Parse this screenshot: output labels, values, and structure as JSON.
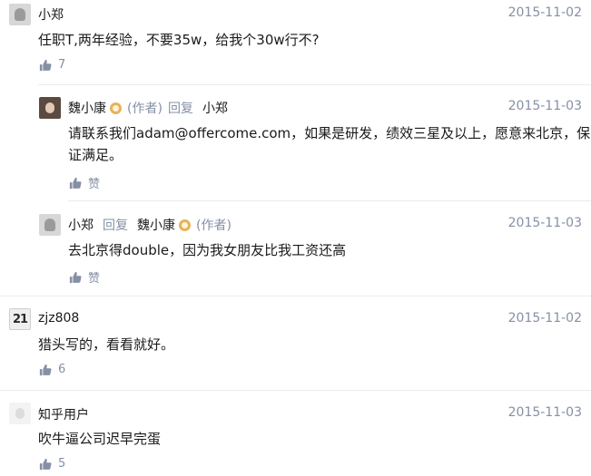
{
  "comments": [
    {
      "author": "小郑",
      "date": "2015-11-02",
      "text": "任职T,两年经验，不要35w，给我个30w行不?",
      "likes": "7",
      "replies": [
        {
          "author": "魏小康",
          "author_tag": "(作者)",
          "reply_word": "回复",
          "reply_to": "小郑",
          "date": "2015-11-03",
          "text_line1": "请联系我们adam@offercome.com，如果是研发，绩效三星及以上，愿意来北京，保",
          "text_line2": "证满足。",
          "like_label": "赞"
        },
        {
          "author": "小郑",
          "reply_word": "回复",
          "reply_to": "魏小康",
          "reply_to_tag": "(作者)",
          "date": "2015-11-03",
          "text": "去北京得double，因为我女朋友比我工资还高",
          "like_label": "赞"
        }
      ]
    },
    {
      "author": "zjz808",
      "avatar_text": "21",
      "date": "2015-11-02",
      "text": "猎头写的，看看就好。",
      "likes": "6"
    },
    {
      "author": "知乎用户",
      "date": "2015-11-03",
      "text": "吹牛逼公司迟早完蛋",
      "likes": "5"
    }
  ],
  "colors": {
    "meta": "#8590a6",
    "text": "#1a1a1a",
    "badge": "#e6b35a",
    "divider": "#ececec"
  }
}
